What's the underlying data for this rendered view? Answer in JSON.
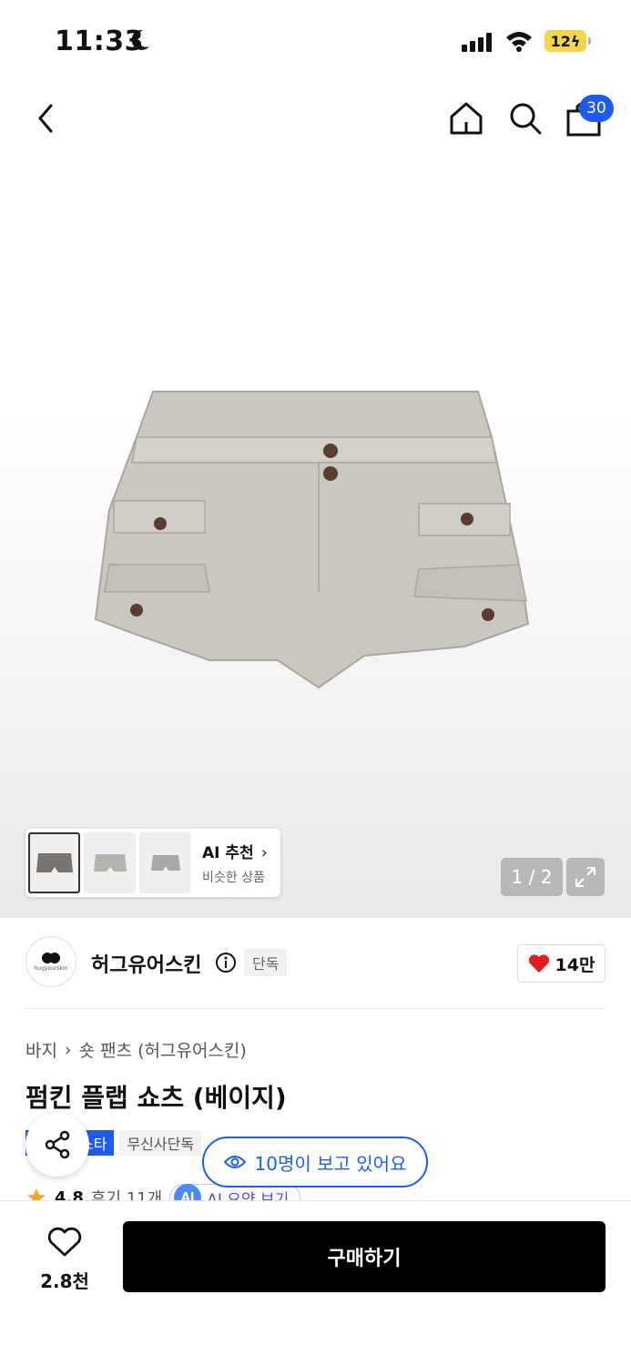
{
  "status_bar": {
    "time": "11:33",
    "battery": "12"
  },
  "header": {
    "cart_count": "30"
  },
  "gallery": {
    "page_indicator": "1 / 2",
    "ai_recommend": {
      "title": "AI 추천",
      "subtitle": "비슷한 상품"
    }
  },
  "brand": {
    "name": "허그유어스킨",
    "logo_text": "hugyourskin",
    "exclusive_tag": "단독",
    "likes": "14만"
  },
  "breadcrumb": {
    "category": "바지",
    "subcategory": "숏 팬츠 (허그유어스킨)"
  },
  "product": {
    "title": "펌킨 플랩 쇼츠 (베이지)",
    "tags": [
      "스타",
      "무신사단독"
    ],
    "rating": "4.8",
    "reviews": "후기 11개",
    "ai_summary": "AI 요약 보기",
    "ai_badge": "AI"
  },
  "viewers": {
    "text": "10명이 보고 있어요"
  },
  "bottom": {
    "wish_count": "2.8천",
    "buy_label": "구매하기"
  },
  "colors": {
    "accent": "#1e5bf5",
    "heart": "#e31b23",
    "product": "#c8c6bf"
  }
}
